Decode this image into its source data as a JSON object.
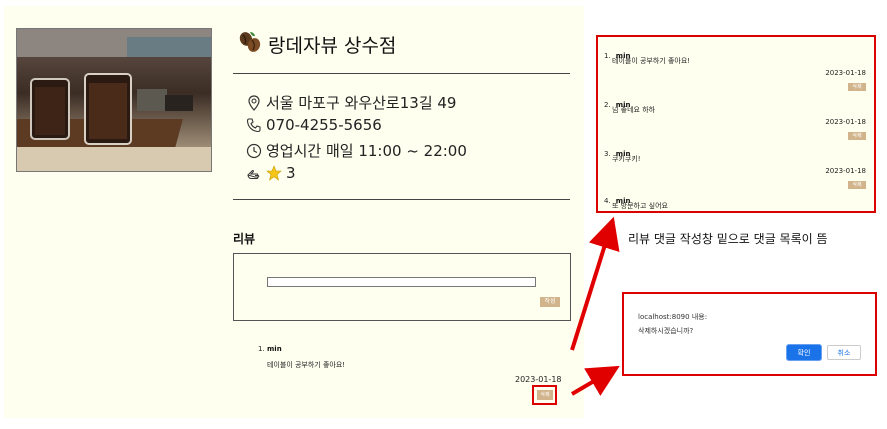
{
  "store": {
    "name": "랑데자뷰 상수점",
    "address": "서울 마포구 와우산로13길 49",
    "phone": "070-4255-5656",
    "hours": "영업시간 매일 11:00 ~ 22:00",
    "rating": "3"
  },
  "review": {
    "heading": "리뷰",
    "input_value": "",
    "write_label": "작성",
    "comments": [
      {
        "num": "1.",
        "author": "min",
        "text": "테이블이 공부하기 좋아요!",
        "date": "2023-01-18",
        "delete_label": "삭제"
      }
    ]
  },
  "list_panel": {
    "comments": [
      {
        "num": "1.",
        "author": "min",
        "text": "테이블이 공부하기 좋아요!",
        "date": "2023-01-18",
        "delete_label": "삭제"
      },
      {
        "num": "2.",
        "author": "min",
        "text": "넘 좋네요 하하",
        "date": "2023-01-18",
        "delete_label": "삭제"
      },
      {
        "num": "3.",
        "author": "min",
        "text": "쿠키쿠키!",
        "date": "2023-01-18",
        "delete_label": "삭제"
      },
      {
        "num": "4.",
        "author": "min",
        "text": "또 방문하고 싶어요",
        "date": "",
        "delete_label": ""
      }
    ]
  },
  "annotation": {
    "note": "리뷰 댓글 작성창 밑으로 댓글 목록이 뜸"
  },
  "dialog": {
    "title": "localhost:8090 내용:",
    "message": "삭제하시겠습니까?",
    "ok_label": "확인",
    "cancel_label": "취소"
  },
  "colors": {
    "panel_bg": "#fffff0",
    "button_tan": "#d2b48c",
    "highlight_red": "#dd0000",
    "ok_blue": "#1a73e8"
  }
}
